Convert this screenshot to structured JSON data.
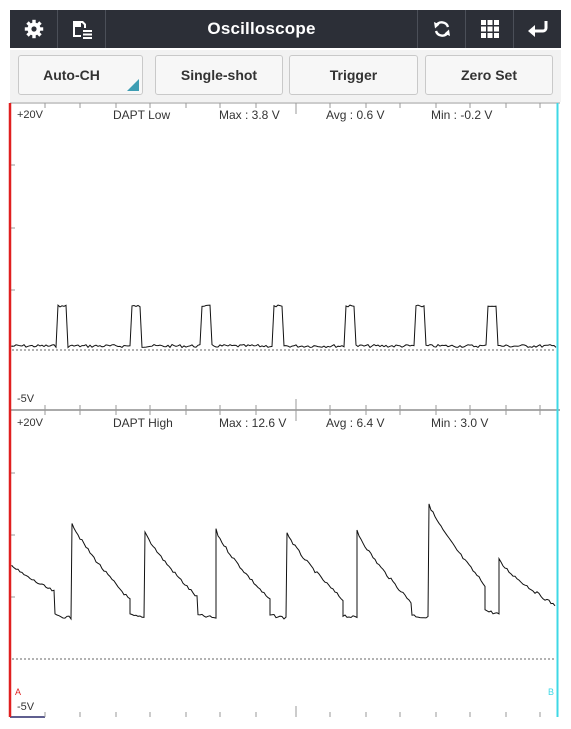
{
  "app": {
    "title": "Oscilloscope",
    "icons_left": [
      "gear-icon",
      "save-icon"
    ],
    "icons_right": [
      "refresh-icon",
      "grid-icon",
      "back-icon"
    ]
  },
  "buttons": {
    "auto_ch": "Auto-CH",
    "single_shot": "Single-shot",
    "trigger": "Trigger",
    "zero_set": "Zero Set"
  },
  "colors": {
    "topbar": "#2c2f37",
    "cursor_a": "#e02020",
    "cursor_b": "#3fd8e6",
    "corner_marker": "#3d9db3"
  },
  "channels": [
    {
      "top_scale": "+20V",
      "name": "DAPT Low",
      "max": "Max : 3.8 V",
      "avg": "Avg : 0.6 V",
      "min": "Min : -0.2 V",
      "bottom_scale": "-5V"
    },
    {
      "top_scale": "+20V",
      "name": "DAPT High",
      "max": "Max : 12.6 V",
      "avg": "Avg : 6.4 V",
      "min": "Min : 3.0 V",
      "bottom_scale": "-5V"
    }
  ],
  "cursors": {
    "a_label": "A",
    "b_label": "B"
  }
}
